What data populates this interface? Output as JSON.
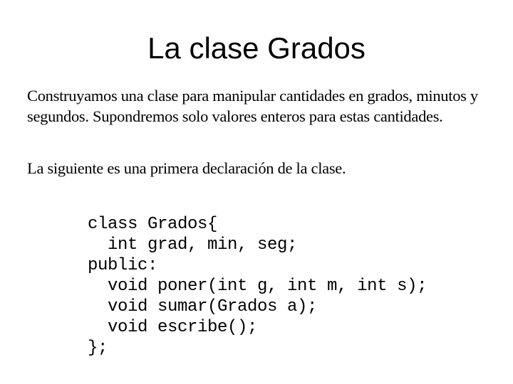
{
  "slide": {
    "title": "La clase Grados",
    "paragraphs": [
      "Construyamos una clase para manipular cantidades en grados, minutos y segundos. Supondremos solo valores enteros para estas cantidades.",
      "La siguiente es una primera declaración de la clase."
    ],
    "code_lines": [
      "class Grados{",
      "  int grad, min, seg;",
      "public:",
      "  void poner(int g, int m, int s);",
      "  void sumar(Grados a);",
      "  void escribe();",
      "};"
    ]
  }
}
